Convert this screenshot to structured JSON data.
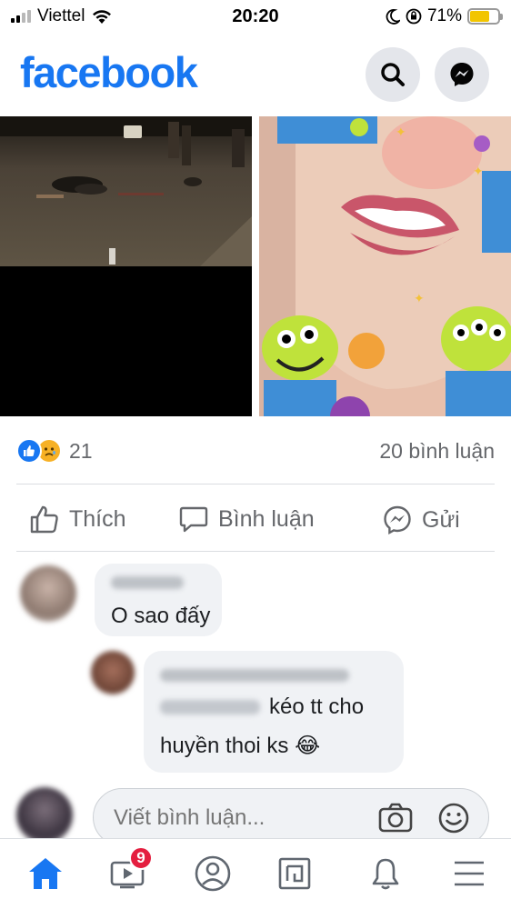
{
  "status_bar": {
    "carrier": "Viettel",
    "time": "20:20",
    "battery": "71%",
    "battery_level": 0.71
  },
  "header": {
    "logo": "facebook",
    "search_icon": "search-icon",
    "messenger_icon": "messenger-icon"
  },
  "post": {
    "reaction_count": "21",
    "comment_count": "20 bình luận",
    "actions": {
      "like": "Thích",
      "comment": "Bình luận",
      "send": "Gửi"
    }
  },
  "comments": [
    {
      "text": "O sao đấy"
    },
    {
      "text_line1": "kéo tt cho",
      "text_line2": "huyền thoi ks",
      "emoji": "😂"
    }
  ],
  "compose": {
    "placeholder": "Viết bình luận..."
  },
  "bottom_nav": {
    "watch_badge": "9"
  },
  "colors": {
    "brand": "#1877f2",
    "badge": "#e41e3f",
    "battery": "#f2c500"
  }
}
